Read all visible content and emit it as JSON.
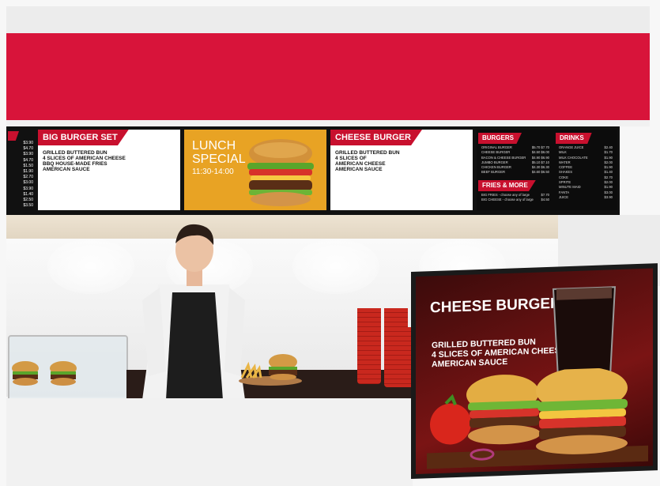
{
  "boards": {
    "big_burger": {
      "title": "BIG BURGER SET",
      "lines": [
        "GRILLED BUTTERED BUN",
        "4 SLICES OF AMERICAN CHEESE",
        "BBQ HOUSE-MADE FRIES",
        "AMERICAN SAUCE"
      ]
    },
    "lunch": {
      "line1": "LUNCH",
      "line2": "SPECIAL",
      "time": "11:30-14:00"
    },
    "cheese_burger": {
      "title": "CHEESE BURGER",
      "lines": [
        "GRILLED BUTTERED BUN",
        "4 SLICES OF",
        "AMERICAN CHEESE",
        "AMERICAN SAUCE"
      ]
    },
    "left_prices": [
      "$3.90",
      "$4.70",
      "$3.90",
      "$4.70",
      "$1.50",
      "$1.90",
      "$2.70",
      "$3.00",
      "$3.90",
      "$1.40",
      "$2.50",
      "$3.50"
    ],
    "menu": {
      "burgers_title": "BURGERS",
      "burgers": [
        {
          "name": "ORIGINAL BURGER",
          "p1": "$5.70",
          "p2": "$7.70"
        },
        {
          "name": "CHEESE BURGER",
          "p1": "$4.50",
          "p2": "$6.00"
        },
        {
          "name": "BACON & CHEESE BURGER",
          "p1": "$4.90",
          "p2": "$6.90"
        },
        {
          "name": "JUMBO BURGER",
          "p1": "$5.10",
          "p2": "$7.10"
        },
        {
          "name": "CHICKEN BURGER",
          "p1": "$4.30",
          "p2": "$6.30"
        },
        {
          "name": "BEEF BURGER",
          "p1": "$4.60",
          "p2": "$6.50"
        }
      ],
      "fries_title": "FRIES & MORE",
      "fries": [
        {
          "name": "BIG FRIES - choose any of large",
          "p1": "$7.70"
        },
        {
          "name": "BIG CHEESE - choose any of large",
          "p1": "$4.50"
        }
      ],
      "drinks_title": "DRINKS",
      "drinks": [
        {
          "name": "ORANGE JUICE",
          "p": "$2.40"
        },
        {
          "name": "MILK",
          "p": "$1.70"
        },
        {
          "name": "MILK CHOCOLATE",
          "p": "$1.90"
        },
        {
          "name": "WATER",
          "p": "$2.00"
        },
        {
          "name": "COFFEE",
          "p": "$1.90"
        },
        {
          "name": "SHAKES",
          "p": "$1.40"
        },
        {
          "name": "COKE",
          "p": "$2.70"
        },
        {
          "name": "SPRITE",
          "p": "$2.00"
        },
        {
          "name": "MINUTE MAID",
          "p": "$1.90"
        },
        {
          "name": "FANTA",
          "p": "$3.00"
        },
        {
          "name": "JUICE",
          "p": "$3.90"
        }
      ]
    }
  },
  "tv": {
    "title": "CHEESE BURGER",
    "lines": [
      "GRILLED BUTTERED BUN",
      "4 SLICES OF AMERICAN CHEESE",
      "AMERICAN SAUCE"
    ]
  },
  "colors": {
    "brand_red": "#d8143a",
    "tag_red": "#c8102e",
    "lunch_yellow": "#e8a324"
  }
}
